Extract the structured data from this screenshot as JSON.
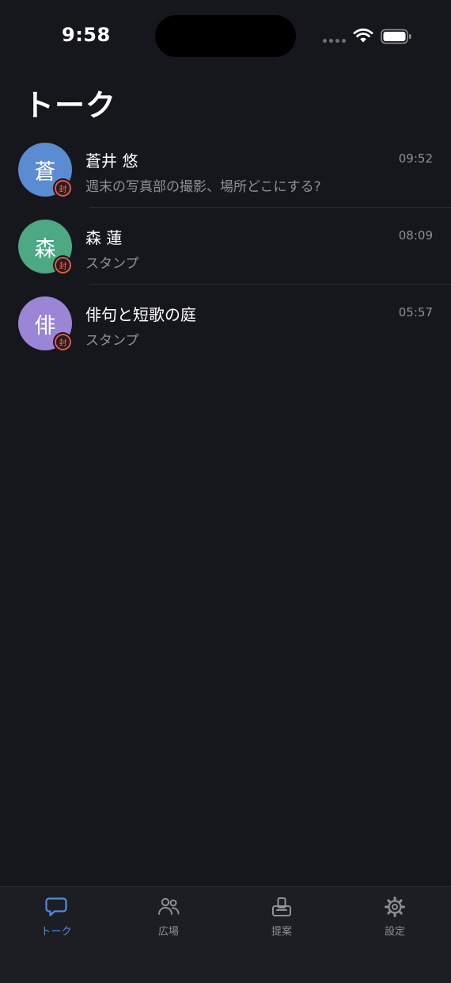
{
  "status_bar": {
    "time": "9:58"
  },
  "page": {
    "title": "トーク"
  },
  "chats": [
    {
      "avatar_char": "蒼",
      "avatar_color": "#5b8bd0",
      "badge": "封",
      "name": "蒼井 悠",
      "time": "09:52",
      "preview": "週末の写真部の撮影、場所どこにする?"
    },
    {
      "avatar_char": "森",
      "avatar_color": "#4da884",
      "badge": "封",
      "name": "森 蓮",
      "time": "08:09",
      "preview": "スタンプ"
    },
    {
      "avatar_char": "俳",
      "avatar_color": "#9b85d6",
      "badge": "封",
      "name": "俳句と短歌の庭",
      "time": "05:57",
      "preview": "スタンプ"
    }
  ],
  "tabs": [
    {
      "label": "トーク",
      "icon": "chat-bubble-icon",
      "active": true
    },
    {
      "label": "広場",
      "icon": "people-icon",
      "active": false
    },
    {
      "label": "提案",
      "icon": "suggestion-box-icon",
      "active": false
    },
    {
      "label": "設定",
      "icon": "gear-icon",
      "active": false
    }
  ],
  "colors": {
    "background": "#16171c",
    "accent": "#4d8ee0",
    "secondary_text": "#8e9096",
    "badge": "#e2574c"
  }
}
